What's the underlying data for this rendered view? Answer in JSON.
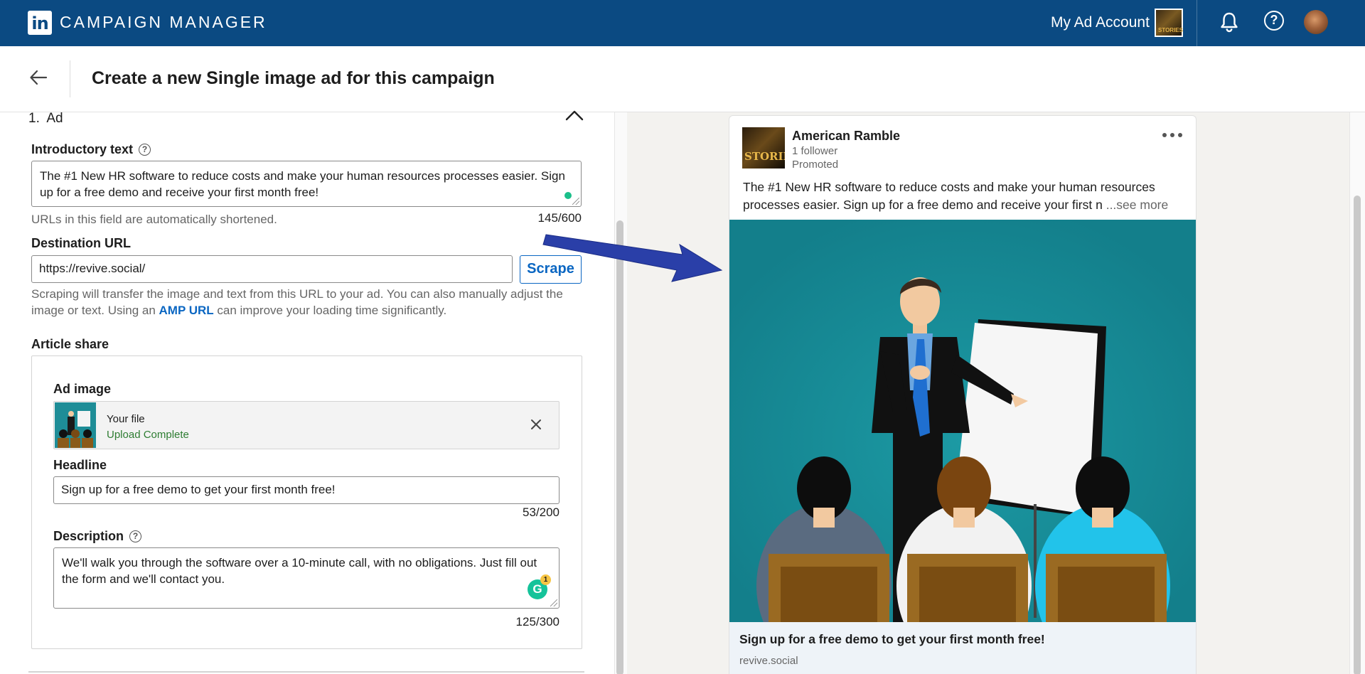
{
  "topbar": {
    "logo_text": "in",
    "app_title": "CAMPAIGN MANAGER",
    "account_name": "My Ad Account",
    "account_avatar_text": "STORIES",
    "icons": [
      "bell-icon",
      "help-icon",
      "user-avatar"
    ],
    "help_glyph": "?"
  },
  "header": {
    "title": "Create a new Single image ad for this campaign",
    "back_icon": "arrow-left-icon"
  },
  "form": {
    "section_title": "1.  Ad",
    "intro": {
      "label": "Introductory text",
      "help_glyph": "?",
      "value": "The #1 New HR software to reduce costs and make your human resources processes easier. Sign up for a free demo and receive your first month free!",
      "hint": "URLs in this field are automatically shortened.",
      "counter": "145/600"
    },
    "destination": {
      "label": "Destination URL",
      "value": "https://revive.social/",
      "scrape_label": "Scrape",
      "hint_before": "Scraping will transfer the image and text from this URL to your ad. You can also manually adjust the image or text. Using an ",
      "hint_link": "AMP URL",
      "hint_after": " can improve your loading time significantly."
    },
    "article_share": {
      "label": "Article share",
      "ad_image_label": "Ad image",
      "file_name": "Your file",
      "file_status": "Upload Complete",
      "headline_label": "Headline",
      "headline_value": "Sign up for a free demo to get your first month free!",
      "headline_counter": "53/200",
      "description_label": "Description",
      "description_help_glyph": "?",
      "description_value": "We'll walk you through the software over a 10-minute call, with no obligations. Just fill out the form and we'll contact you.",
      "description_counter": "125/300",
      "grammarly_letter": "G",
      "grammarly_count": "1"
    }
  },
  "preview": {
    "company_name": "American Ramble",
    "company_logo_text": "STORIES",
    "followers": "1 follower",
    "promoted": "Promoted",
    "post_text": "The #1 New HR software to reduce costs and make your human resources processes easier. Sign up for a free demo and receive your first n",
    "see_more": "...see more",
    "ad_headline": "Sign up for a free demo to get your first month free!",
    "ad_domain": "revive.social"
  },
  "colors": {
    "topbar": "#0b4a82",
    "link": "#0a66c2",
    "success": "#2e7d32",
    "preview_bg": "#1a8b96",
    "arrow": "#2a3fa8"
  }
}
